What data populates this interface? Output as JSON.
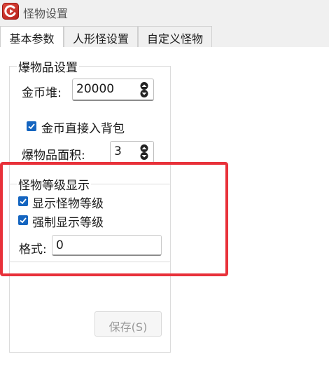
{
  "window": {
    "title": "怪物设置",
    "icon": "app-logo-icon"
  },
  "tabs": [
    {
      "label": "基本参数",
      "active": true
    },
    {
      "label": "人形怪设置",
      "active": false
    },
    {
      "label": "自定义怪物",
      "active": false
    }
  ],
  "drops": {
    "legend": "爆物品设置",
    "gold_pile_label": "金币堆:",
    "gold_pile_value": "20000",
    "gold_to_bag_label": "金币直接入背包",
    "gold_to_bag_checked": true,
    "drop_area_label": "爆物品面积:",
    "drop_area_value": "3"
  },
  "level_display": {
    "legend": "怪物等级显示",
    "show_level_label": "显示怪物等级",
    "show_level_checked": true,
    "force_show_label": "强制显示等级",
    "force_show_checked": true,
    "format_label": "格式:",
    "format_value": "0"
  },
  "actions": {
    "save_label": "保存(S)"
  },
  "colors": {
    "accent": "#1565c0",
    "highlight": "#e8313a"
  }
}
